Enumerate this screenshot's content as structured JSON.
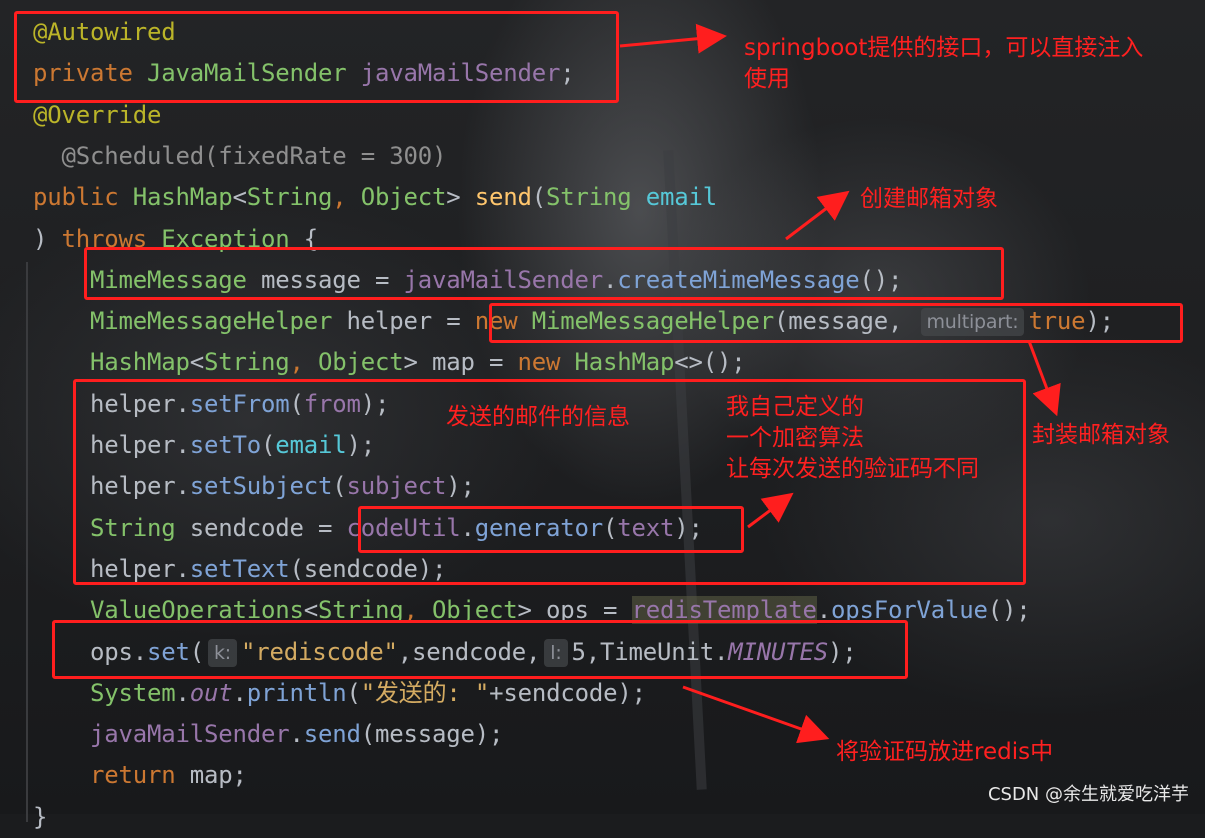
{
  "editor": {
    "lines": [
      {
        "parts": [
          {
            "c": "ann",
            "t": "@Autowired"
          }
        ]
      },
      {
        "parts": [
          {
            "c": "kw",
            "t": "private "
          },
          {
            "c": "typ",
            "t": "JavaMailSender "
          },
          {
            "c": "var",
            "t": "javaMailSender"
          },
          {
            "c": "pl",
            "t": ";"
          }
        ]
      },
      {
        "parts": [
          {
            "c": "ann",
            "t": "@Override"
          }
        ]
      },
      {
        "parts": [
          {
            "c": "ann2",
            "t": "  @Scheduled(fixedRate = 300)"
          }
        ]
      },
      {
        "parts": [
          {
            "c": "kw",
            "t": "public "
          },
          {
            "c": "typ",
            "t": "HashMap"
          },
          {
            "c": "pl",
            "t": "<"
          },
          {
            "c": "typ",
            "t": "String"
          },
          {
            "c": "kw",
            "t": ", "
          },
          {
            "c": "typ",
            "t": "Object"
          },
          {
            "c": "pl",
            "t": "> "
          },
          {
            "c": "fn",
            "t": "send"
          },
          {
            "c": "pl",
            "t": "("
          },
          {
            "c": "typ",
            "t": "String "
          },
          {
            "c": "cyan",
            "t": "email"
          }
        ]
      },
      {
        "parts": [
          {
            "c": "pl",
            "t": ") "
          },
          {
            "c": "kw",
            "t": "throws "
          },
          {
            "c": "typ",
            "t": "Exception "
          },
          {
            "c": "pl",
            "t": "{"
          }
        ]
      },
      {
        "parts": [
          {
            "c": "pl",
            "t": "    "
          },
          {
            "c": "typ",
            "t": "MimeMessage "
          },
          {
            "c": "pl",
            "t": "message = "
          },
          {
            "c": "var",
            "t": "javaMailSender"
          },
          {
            "c": "pl",
            "t": "."
          },
          {
            "c": "mth",
            "t": "createMimeMessage"
          },
          {
            "c": "pl",
            "t": "();"
          }
        ]
      },
      {
        "parts": [
          {
            "c": "pl",
            "t": "    "
          },
          {
            "c": "typ",
            "t": "MimeMessageHelper "
          },
          {
            "c": "pl",
            "t": "helper = "
          },
          {
            "c": "kw",
            "t": "new "
          },
          {
            "c": "typ",
            "t": "MimeMessageHelper"
          },
          {
            "c": "pl",
            "t": "(message, "
          },
          {
            "c": "hint",
            "t": "multipart:"
          },
          {
            "c": "kw",
            "t": "true"
          },
          {
            "c": "pl",
            "t": ");"
          }
        ]
      },
      {
        "parts": [
          {
            "c": "pl",
            "t": "    "
          },
          {
            "c": "typ",
            "t": "HashMap"
          },
          {
            "c": "pl",
            "t": "<"
          },
          {
            "c": "typ",
            "t": "String"
          },
          {
            "c": "kw",
            "t": ", "
          },
          {
            "c": "typ",
            "t": "Object"
          },
          {
            "c": "pl",
            "t": "> map = "
          },
          {
            "c": "kw",
            "t": "new "
          },
          {
            "c": "typ",
            "t": "HashMap"
          },
          {
            "c": "pl",
            "t": "<>();"
          }
        ]
      },
      {
        "parts": [
          {
            "c": "pl",
            "t": "    helper."
          },
          {
            "c": "mth",
            "t": "setFrom"
          },
          {
            "c": "pl",
            "t": "("
          },
          {
            "c": "var",
            "t": "from"
          },
          {
            "c": "pl",
            "t": ");"
          }
        ]
      },
      {
        "parts": [
          {
            "c": "pl",
            "t": "    helper."
          },
          {
            "c": "mth",
            "t": "setTo"
          },
          {
            "c": "pl",
            "t": "("
          },
          {
            "c": "cyan",
            "t": "email"
          },
          {
            "c": "pl",
            "t": ");"
          }
        ]
      },
      {
        "parts": [
          {
            "c": "pl",
            "t": "    helper."
          },
          {
            "c": "mth",
            "t": "setSubject"
          },
          {
            "c": "pl",
            "t": "("
          },
          {
            "c": "var",
            "t": "subject"
          },
          {
            "c": "pl",
            "t": ");"
          }
        ]
      },
      {
        "parts": [
          {
            "c": "pl",
            "t": "    "
          },
          {
            "c": "typ",
            "t": "String "
          },
          {
            "c": "pl",
            "t": "sendcode = "
          },
          {
            "c": "var",
            "t": "codeUtil"
          },
          {
            "c": "pl",
            "t": "."
          },
          {
            "c": "mth",
            "t": "generator"
          },
          {
            "c": "pl",
            "t": "("
          },
          {
            "c": "var",
            "t": "text"
          },
          {
            "c": "pl",
            "t": ");"
          }
        ]
      },
      {
        "parts": [
          {
            "c": "pl",
            "t": "    helper."
          },
          {
            "c": "mth",
            "t": "setText"
          },
          {
            "c": "pl",
            "t": "(sendcode);"
          }
        ]
      },
      {
        "parts": [
          {
            "c": "pl",
            "t": "    "
          },
          {
            "c": "typ",
            "t": "ValueOperations"
          },
          {
            "c": "pl",
            "t": "<"
          },
          {
            "c": "typ",
            "t": "String"
          },
          {
            "c": "kw",
            "t": ", "
          },
          {
            "c": "typ",
            "t": "Object"
          },
          {
            "c": "pl",
            "t": "> ops = "
          },
          {
            "c": "var redis-hl",
            "t": "redisTemplate"
          },
          {
            "c": "pl",
            "t": "."
          },
          {
            "c": "mth",
            "t": "opsForValue"
          },
          {
            "c": "pl",
            "t": "();"
          }
        ]
      },
      {
        "parts": [
          {
            "c": "pl",
            "t": "    ops."
          },
          {
            "c": "mth",
            "t": "set"
          },
          {
            "c": "pl",
            "t": "("
          },
          {
            "c": "hint",
            "t": "k:"
          },
          {
            "c": "str",
            "t": "\"rediscode\""
          },
          {
            "c": "pl",
            "t": ",sendcode,"
          },
          {
            "c": "hint",
            "t": "l:"
          },
          {
            "c": "pl",
            "t": "5,TimeUnit."
          },
          {
            "c": "fld",
            "t": "MINUTES"
          },
          {
            "c": "pl",
            "t": ");"
          }
        ]
      },
      {
        "parts": [
          {
            "c": "pl",
            "t": "    "
          },
          {
            "c": "typ",
            "t": "System"
          },
          {
            "c": "pl",
            "t": "."
          },
          {
            "c": "fld",
            "t": "out"
          },
          {
            "c": "pl",
            "t": "."
          },
          {
            "c": "mth",
            "t": "println"
          },
          {
            "c": "pl",
            "t": "("
          },
          {
            "c": "str",
            "t": "\"发送的: \""
          },
          {
            "c": "pl",
            "t": "+sendcode);"
          }
        ]
      },
      {
        "parts": [
          {
            "c": "pl",
            "t": "    "
          },
          {
            "c": "var",
            "t": "javaMailSender"
          },
          {
            "c": "pl",
            "t": "."
          },
          {
            "c": "mth",
            "t": "send"
          },
          {
            "c": "pl",
            "t": "(message);"
          }
        ]
      },
      {
        "parts": [
          {
            "c": "pl",
            "t": "    "
          },
          {
            "c": "kw",
            "t": "return "
          },
          {
            "c": "pl",
            "t": "map;"
          }
        ]
      },
      {
        "parts": [
          {
            "c": "pl",
            "t": "}"
          }
        ]
      }
    ]
  },
  "annotations": {
    "inject_note": "springboot提供的接口，可以直接注入\n使用",
    "create_note": "创建邮箱对象",
    "wrap_note": "封装邮箱对象",
    "info_note": "发送的邮件的信息",
    "encrypt_note": "我自己定义的\n一个加密算法\n让每次发送的验证码不同",
    "redis_note": "将验证码放进redis中"
  },
  "watermark": "CSDN @余生就爱吃洋芋",
  "colors": {
    "annotation_red": "#ff1e1e",
    "keyword": "#cc7832",
    "type": "#84c26a",
    "field": "#9876aa",
    "method": "#7fa3d6",
    "string": "#d4ab62"
  }
}
